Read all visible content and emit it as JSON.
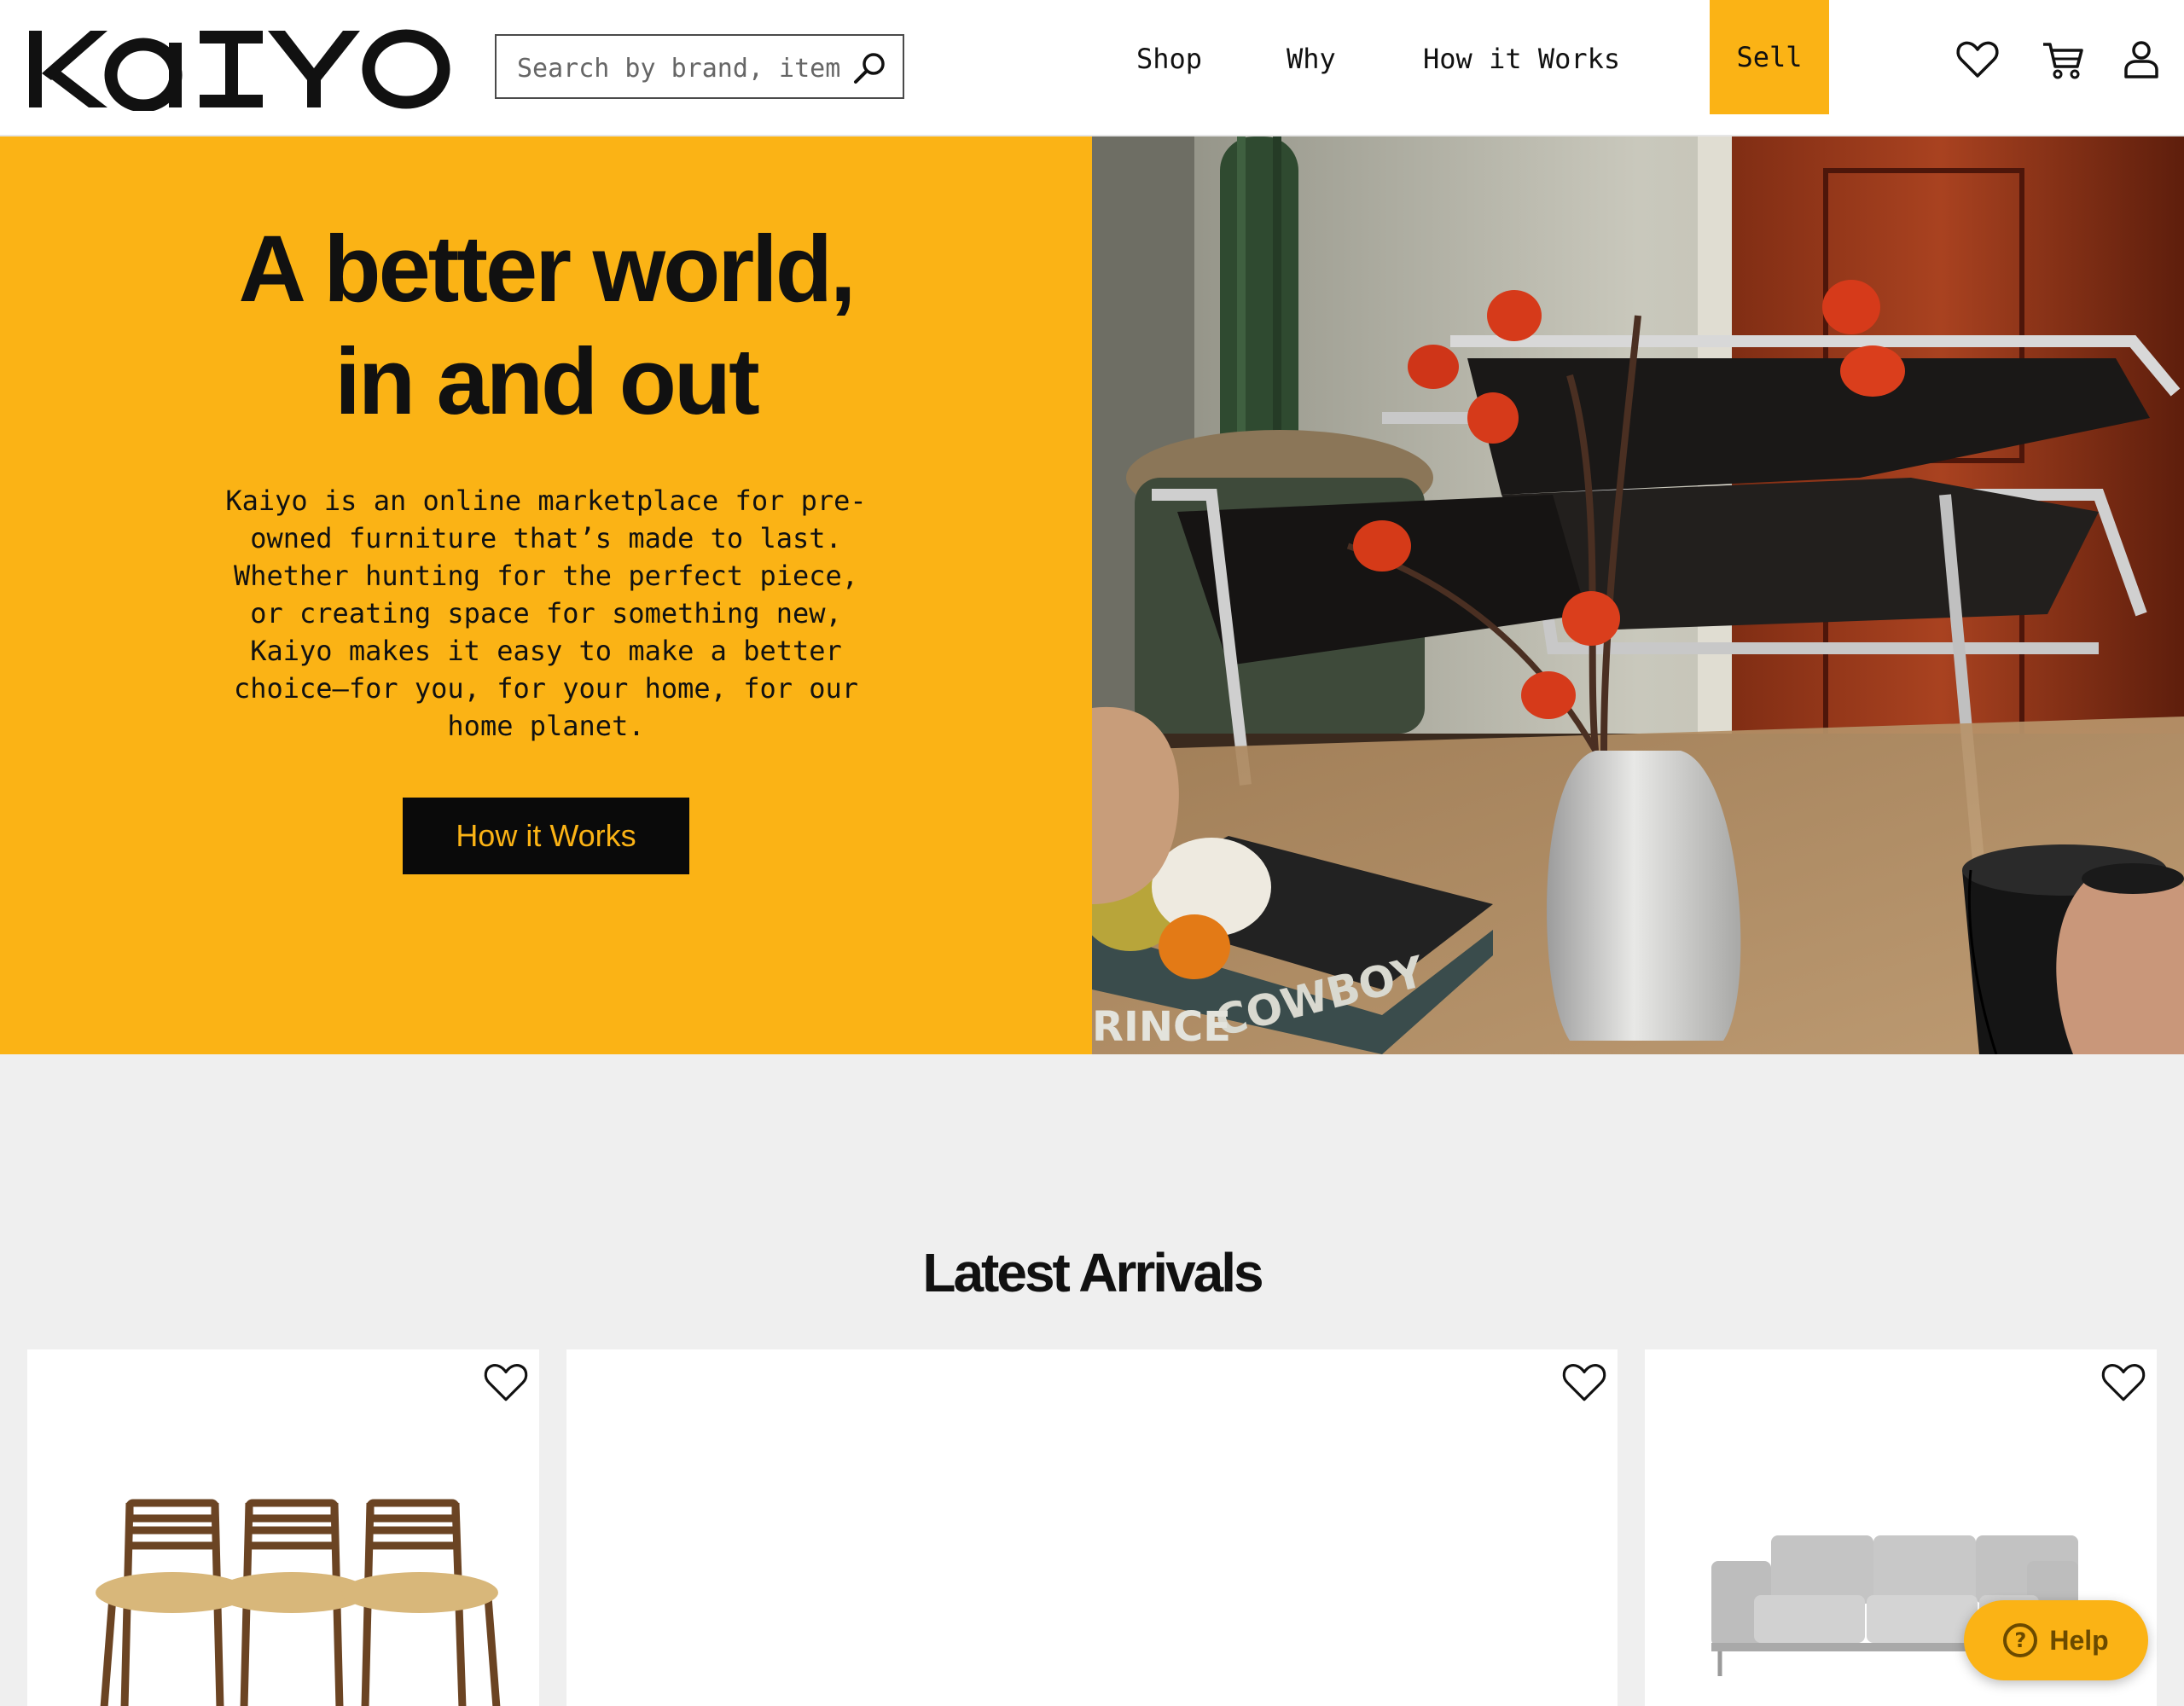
{
  "brand": {
    "logo_text": "KaIYO",
    "accent_color": "#fbb315"
  },
  "search": {
    "placeholder": "Search by brand, item...",
    "icon": "search-icon"
  },
  "nav": {
    "items": [
      {
        "label": "Shop"
      },
      {
        "label": "Why"
      },
      {
        "label": "How it Works"
      }
    ],
    "sell_label": "Sell"
  },
  "header_icons": [
    "heart-icon",
    "cart-icon",
    "user-icon"
  ],
  "hero": {
    "title_line1": "A better world,",
    "title_line2": "in and out",
    "body_lines": [
      "Kaiyo is an online marketplace for pre-",
      "owned furniture that’s made to last.",
      "Whether hunting for the perfect piece,",
      "or creating space for something new,",
      "Kaiyo makes it easy to make a better",
      "choice—for you, for your home, for our",
      "home planet."
    ],
    "cta_label": "How it Works",
    "image_alt": "Chrome and black leather lounge chair beside a glass table with vases and small pumpkins",
    "book_text_1": "COWBOY",
    "book_text_2": "RINCE"
  },
  "latest": {
    "title": "Latest Arrivals",
    "products": [
      {
        "image": "three wooden dining chairs with woven seats"
      },
      {
        "image": ""
      },
      {
        "image": "grey tufted three-seat sofa"
      }
    ]
  },
  "help_widget": {
    "label": "Help",
    "icon": "question-icon"
  }
}
